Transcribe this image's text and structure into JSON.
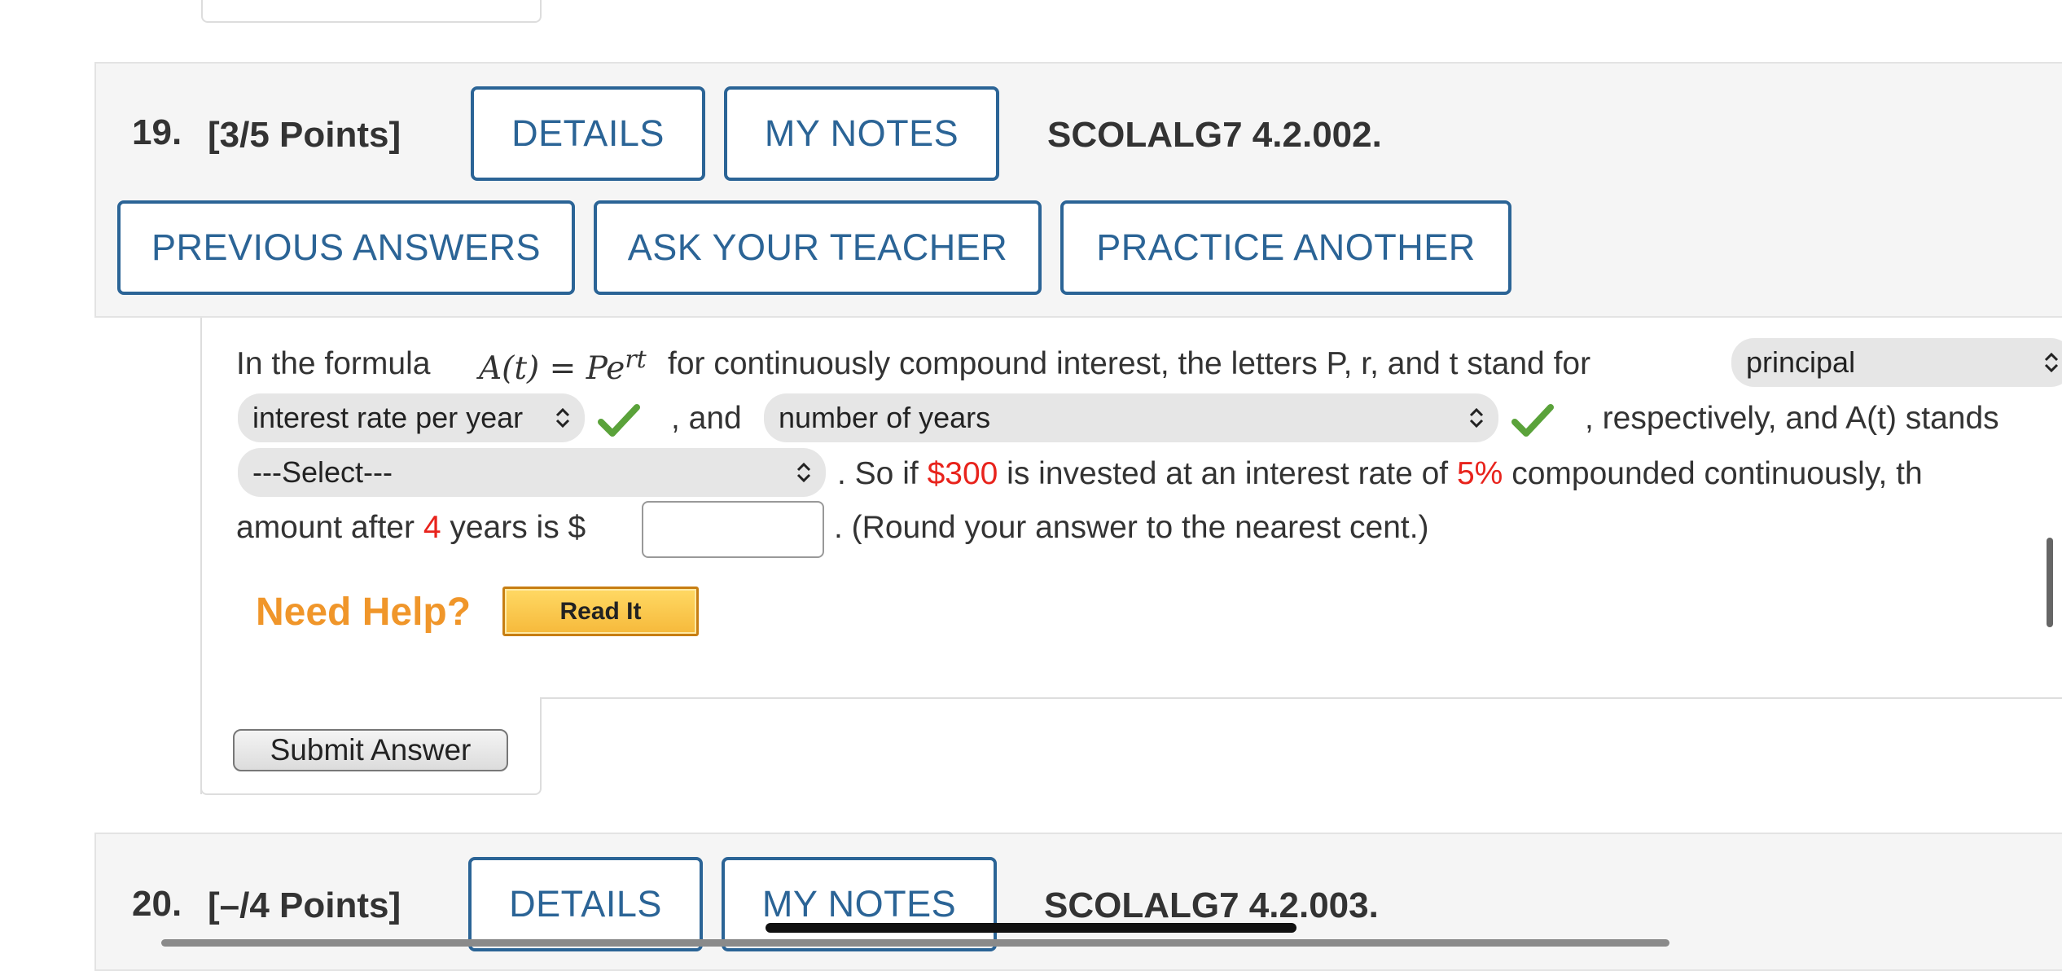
{
  "q19": {
    "number": "19.",
    "points": "[3/5 Points]",
    "details": "DETAILS",
    "my_notes": "MY NOTES",
    "code": "SCOLALG7 4.2.002.",
    "previous_answers": "PREVIOUS ANSWERS",
    "ask_teacher": "ASK YOUR TEACHER",
    "practice_another": "PRACTICE ANOTHER",
    "text_intro": "In the formula",
    "formula_A": "A(t) = Pe",
    "formula_exp": "rt",
    "text_stand_for": "for continuously compound interest, the letters P, r, and t stand for",
    "select_1": "principal",
    "select_2": "interest rate per year",
    "text_and": ", and",
    "select_3": "number of years",
    "text_respectively": ", respectively, and A(t) stands",
    "select_4": "---Select---",
    "text_so_if": ". So if",
    "amount": "$300",
    "text_invested": "is invested at an interest rate of",
    "rate": "5%",
    "text_compounded": "compounded continuously, th",
    "text_amount_after": "amount after",
    "years": "4",
    "text_years_is": "years is $",
    "input_value": "",
    "text_round": ". (Round your answer to the nearest cent.)",
    "need_help": "Need Help?",
    "read_it": "Read It",
    "submit": "Submit Answer"
  },
  "q20": {
    "number": "20.",
    "points": "[–/4 Points]",
    "details": "DETAILS",
    "my_notes": "MY NOTES",
    "code": "SCOLALG7 4.2.003."
  },
  "colors": {
    "accent_blue": "#2b6496",
    "highlight_red": "#e8231c",
    "help_orange": "#f0962a",
    "check_green": "#5aa23a"
  }
}
